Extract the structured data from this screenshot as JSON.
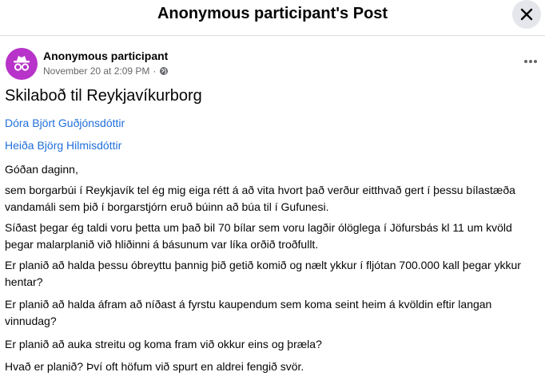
{
  "modal": {
    "title": "Anonymous participant's Post",
    "close_icon": "close-icon"
  },
  "post": {
    "author": "Anonymous participant",
    "timestamp": "November 20 at 2:09 PM",
    "separator": "·",
    "privacy_icon": "globe-icon",
    "avatar_icon": "incognito-icon",
    "avatar_color": "#b733c9",
    "more_icon": "more-options-icon",
    "title": "Skilaboð til Reykjavíkurborg",
    "mentions": [
      "Dóra Björt Guðjónsdóttir",
      "Heiða Björg Hilmisdóttir"
    ],
    "mention_color": "#216fdb",
    "paragraphs": [
      "Góðan daginn,",
      "sem borgarbúi í Reykjavík tel ég mig eiga rétt á að vita hvort það verður eitthvað gert í þessu bílastæða vandamáli sem þið í borgarstjórn eruð búinn að búa til í Gufunesi.",
      "Síðast þegar ég taldi voru þetta um það bil 70 bílar sem voru lagðir ólöglega í Jöfursbás kl 11 um kvöld þegar malarplanið við hliðinni á básunum var líka orðið troðfullt.",
      "Er planið að halda þessu óbreyttu þannig þið getið komið og nælt ykkur í fljótan 700.000 kall þegar ykkur hentar?",
      "Er planið að halda áfram að níðast á fyrstu kaupendum sem koma seint heim á kvöldin eftir langan vinnudag?",
      "Er planið að auka streitu og koma fram við okkur eins og þræla?",
      "Hvað er planið? Því oft höfum við spurt en aldrei fengið svör."
    ]
  }
}
